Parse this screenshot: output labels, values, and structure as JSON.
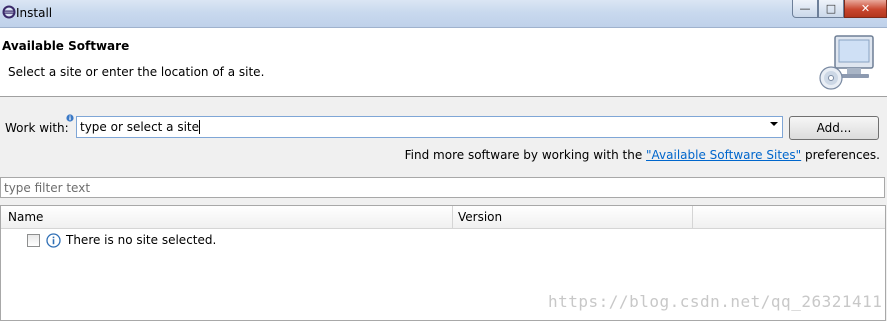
{
  "window": {
    "title": "Install",
    "controls": {
      "minimize": "—",
      "maximize": "□",
      "close": "✕"
    }
  },
  "header": {
    "title": "Available Software",
    "description": "Select a site or enter the location of a site."
  },
  "work_with": {
    "label": "Work with:",
    "value": "type or select a site",
    "add_button": "Add..."
  },
  "find_more": {
    "prefix": "Find more software by working with the ",
    "link": "\"Available Software Sites\"",
    "suffix": " preferences."
  },
  "filter": {
    "placeholder": "type filter text"
  },
  "table": {
    "columns": [
      "Name",
      "Version"
    ],
    "rows": [
      {
        "text": "There is no site selected.",
        "checked": false
      }
    ]
  },
  "watermark": "https://blog.csdn.net/qq_26321411",
  "colors": {
    "link": "#0066cc",
    "title_bar": "#c9d9ee",
    "close_button": "#c9472f"
  }
}
